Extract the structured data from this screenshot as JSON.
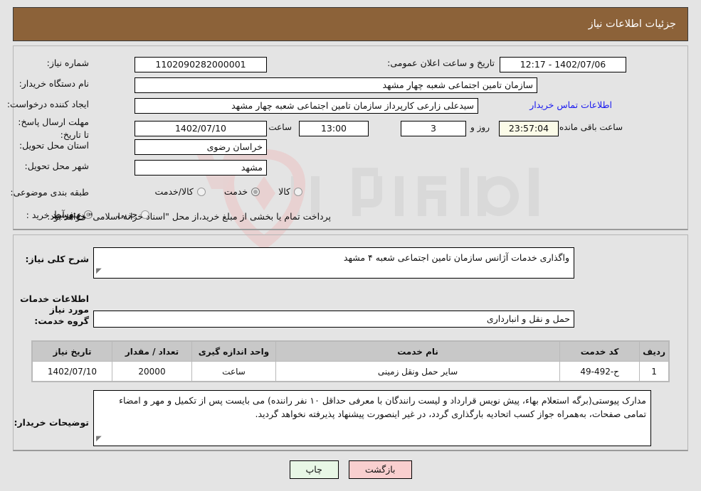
{
  "header": {
    "title": "جزئیات اطلاعات نیاز"
  },
  "info": {
    "need_number_label": "شماره نیاز:",
    "need_number_value": "1102090282000001",
    "announce_label": "تاریخ و ساعت اعلان عمومی:",
    "announce_value": "1402/07/06 - 12:17",
    "buyer_org_label": "نام دستگاه خریدار:",
    "buyer_org_value": "سازمان تامین اجتماعی شعبه چهار مشهد",
    "creator_label": "ایجاد کننده درخواست:",
    "creator_value": "سیدعلی زارعی کارپرداز سازمان تامین اجتماعی شعبه چهار مشهد",
    "contact_link": "اطلاعات تماس خریدار",
    "deadline_label": "مهلت ارسال پاسخ: تا تاریخ:",
    "deadline_date": "1402/07/10",
    "hour_label": "ساعت",
    "deadline_time": "13:00",
    "days_value": "3",
    "days_label": "روز و",
    "timer_value": "23:57:04",
    "remaining_label": "ساعت باقی مانده",
    "province_label": "استان محل تحویل:",
    "province_value": "خراسان رضوی",
    "city_label": "شهر محل تحویل:",
    "city_value": "مشهد",
    "category_label": "طبقه بندی موضوعی:",
    "category_options": [
      {
        "label": "کالا",
        "selected": false
      },
      {
        "label": "خدمت",
        "selected": true
      },
      {
        "label": "کالا/خدمت",
        "selected": false
      }
    ],
    "process_label": "نوع فرآیند خرید :",
    "process_options": [
      {
        "label": "جزیی",
        "selected": false
      },
      {
        "label": "متوسط",
        "selected": true
      }
    ],
    "payment_note": "پرداخت تمام یا بخشی از مبلغ خرید،از محل \"اسناد خزانه اسلامی\" خواهد بود."
  },
  "details": {
    "general_desc_label": "شرح کلی نیاز:",
    "general_desc_value": "واگذاری خدمات آژانس سازمان تامین اجتماعی شعبه ۴ مشهد",
    "services_heading": "اطلاعات خدمات مورد نیاز",
    "service_group_label": "گروه خدمت:",
    "service_group_value": "حمل و نقل و انبارداری"
  },
  "table": {
    "headers": [
      "ردیف",
      "کد خدمت",
      "نام خدمت",
      "واحد اندازه گیری",
      "تعداد / مقدار",
      "تاریخ نیاز"
    ],
    "rows": [
      {
        "radif": "1",
        "code": "ح-492-49",
        "name": "سایر حمل ونقل زمینی",
        "unit": "ساعت",
        "qty": "20000",
        "date": "1402/07/10"
      }
    ]
  },
  "buyer_notes": {
    "label": "توضیحات خریدار:",
    "value": "مدارک  پیوستی(برگه استعلام بهاء، پیش نویس قرارداد و لیست رانندگان با معرفی حداقل ۱۰ نفر راننده) می بایست پس از تکمیل و مهر و امضاء تمامی صفحات، به‌همراه جواز کسب اتحادیه  بارگذاری گردد، در غیر اینصورت پیشنهاد پذیرفته نخواهد گردید."
  },
  "footer": {
    "back_label": "بازگشت",
    "print_label": "چاپ"
  },
  "colors": {
    "header_bg": "#8c6239",
    "link": "#1a1af0",
    "timer_bg": "#fbfbe8",
    "back_btn_bg": "#f9cfcf",
    "print_btn_bg": "#e8f7e6"
  }
}
